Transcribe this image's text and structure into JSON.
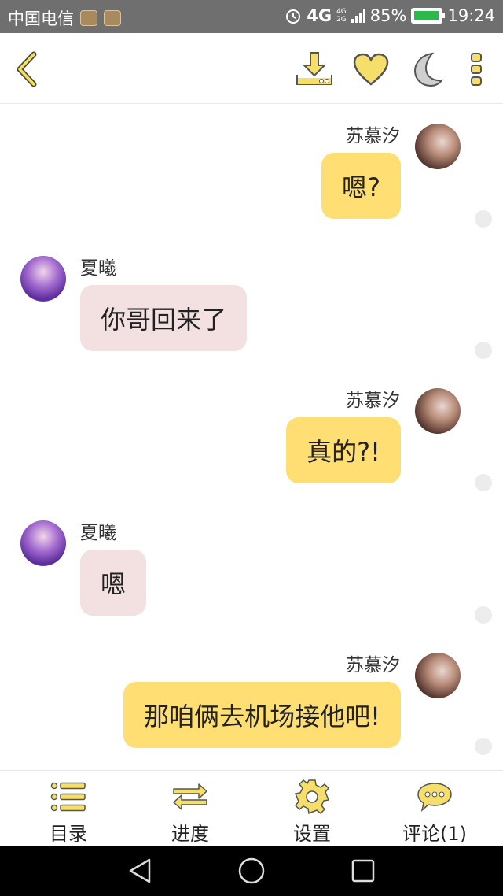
{
  "status_bar": {
    "carrier": "中国电信",
    "network": "4G",
    "network_small_top": "4G",
    "network_small_bottom": "2G",
    "battery_percent": "85%",
    "time": "19:24"
  },
  "header": {
    "icons": [
      "back-icon",
      "download-icon",
      "heart-icon",
      "moon-icon",
      "more-icon"
    ]
  },
  "messages": [
    {
      "side": "right",
      "sender": "苏慕汐",
      "text": "嗯?"
    },
    {
      "side": "left",
      "sender": "夏曦",
      "text": "你哥回来了"
    },
    {
      "side": "right",
      "sender": "苏慕汐",
      "text": "真的?!"
    },
    {
      "side": "left",
      "sender": "夏曦",
      "text": "嗯"
    },
    {
      "side": "right",
      "sender": "苏慕汐",
      "text": "那咱俩去机场接他吧!"
    }
  ],
  "tabbar": {
    "catalog": "目录",
    "progress": "进度",
    "settings": "设置",
    "comments": "评论(1)"
  },
  "colors": {
    "accent_yellow": "#ffde73",
    "icon_yellow": "#f5df6a",
    "left_bubble": "#f3e0e0",
    "status_bar": "#6f6f6f"
  }
}
